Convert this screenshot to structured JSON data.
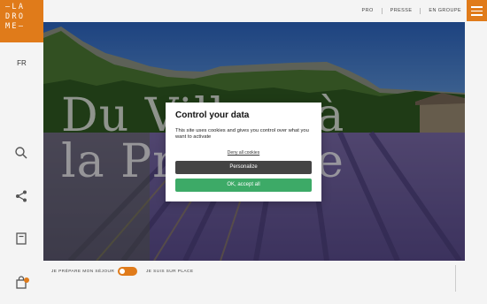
{
  "colors": {
    "brand": "#e07b1a",
    "accept": "#3daa67",
    "personalize": "#444444"
  },
  "logo": {
    "line1": "—LA",
    "line2": "DRO",
    "line3": "ME—"
  },
  "sidebar": {
    "language": "FR",
    "icons": [
      "search-icon",
      "share-icon",
      "bookmark-icon",
      "bag-icon"
    ]
  },
  "topnav": {
    "links": [
      "PRO",
      "PRESSE",
      "EN GROUPE"
    ]
  },
  "hero": {
    "title_line1": "Du Villars à",
    "title_line2": "la Provence"
  },
  "strip": {
    "left_label": "JE PRÉPARE MON SÉJOUR",
    "right_label": "JE SUIS SUR PLACE"
  },
  "cookie": {
    "title": "Control your data",
    "text": "This site uses cookies and gives you control over what you want to activate",
    "deny": "Deny all cookies",
    "personalize": "Personalize",
    "accept": "OK, accept all"
  }
}
